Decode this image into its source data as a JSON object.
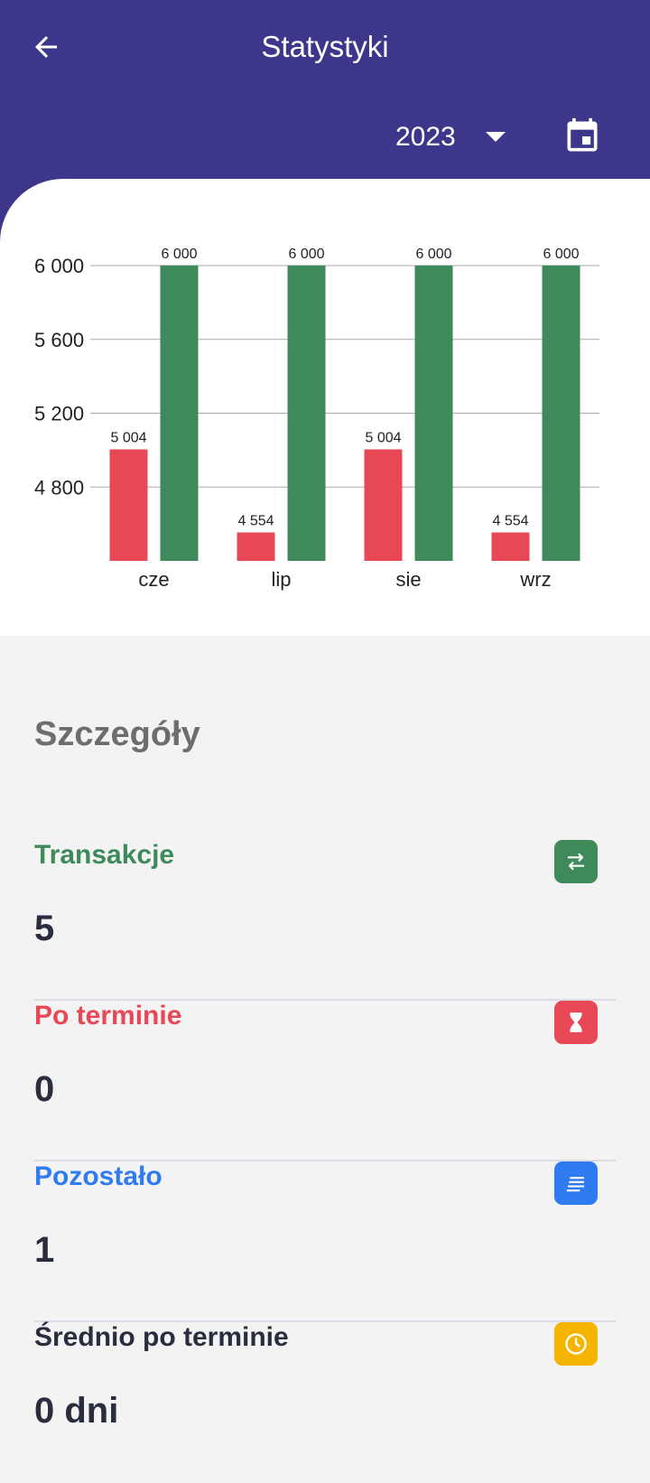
{
  "header": {
    "title": "Statystyki",
    "year": "2023",
    "back_icon": "arrow-left-icon",
    "dropdown_icon": "caret-down-icon",
    "calendar_icon": "calendar-icon",
    "background": "#3d378b"
  },
  "chart_data": {
    "type": "bar",
    "categories": [
      "cze",
      "lip",
      "sie",
      "wrz"
    ],
    "series": [
      {
        "color": "#e84756",
        "values": [
          5004,
          4554,
          5004,
          4554
        ]
      },
      {
        "color": "#3e8a5b",
        "values": [
          6000,
          6000,
          6000,
          6000
        ]
      }
    ],
    "value_labels": [
      [
        "5 004",
        "4 554",
        "5 004",
        "4 554"
      ],
      [
        "6 000",
        "6 000",
        "6 000",
        "6 000"
      ]
    ],
    "ytick_values": [
      4800,
      5200,
      5600,
      6000
    ],
    "ytick_labels": [
      "4 800",
      "5 200",
      "5 600",
      "6 000"
    ],
    "ylim": [
      4400,
      6000
    ],
    "grid": true,
    "title": "",
    "xlabel": "",
    "ylabel": ""
  },
  "details": {
    "title": "Szczegóły",
    "items": [
      {
        "label": "Transakcje",
        "value": "5",
        "icon": "swap-arrows-icon",
        "color": "#3e8a5b"
      },
      {
        "label": "Po terminie",
        "value": "0",
        "icon": "hourglass-icon",
        "color": "#e84756"
      },
      {
        "label": "Pozostało",
        "value": "1",
        "icon": "list-lines-icon",
        "color": "#2f7bf0"
      },
      {
        "label": "Średnio po terminie",
        "value": "0 dni",
        "icon": "clock-icon",
        "color": "#f6b400"
      }
    ]
  }
}
